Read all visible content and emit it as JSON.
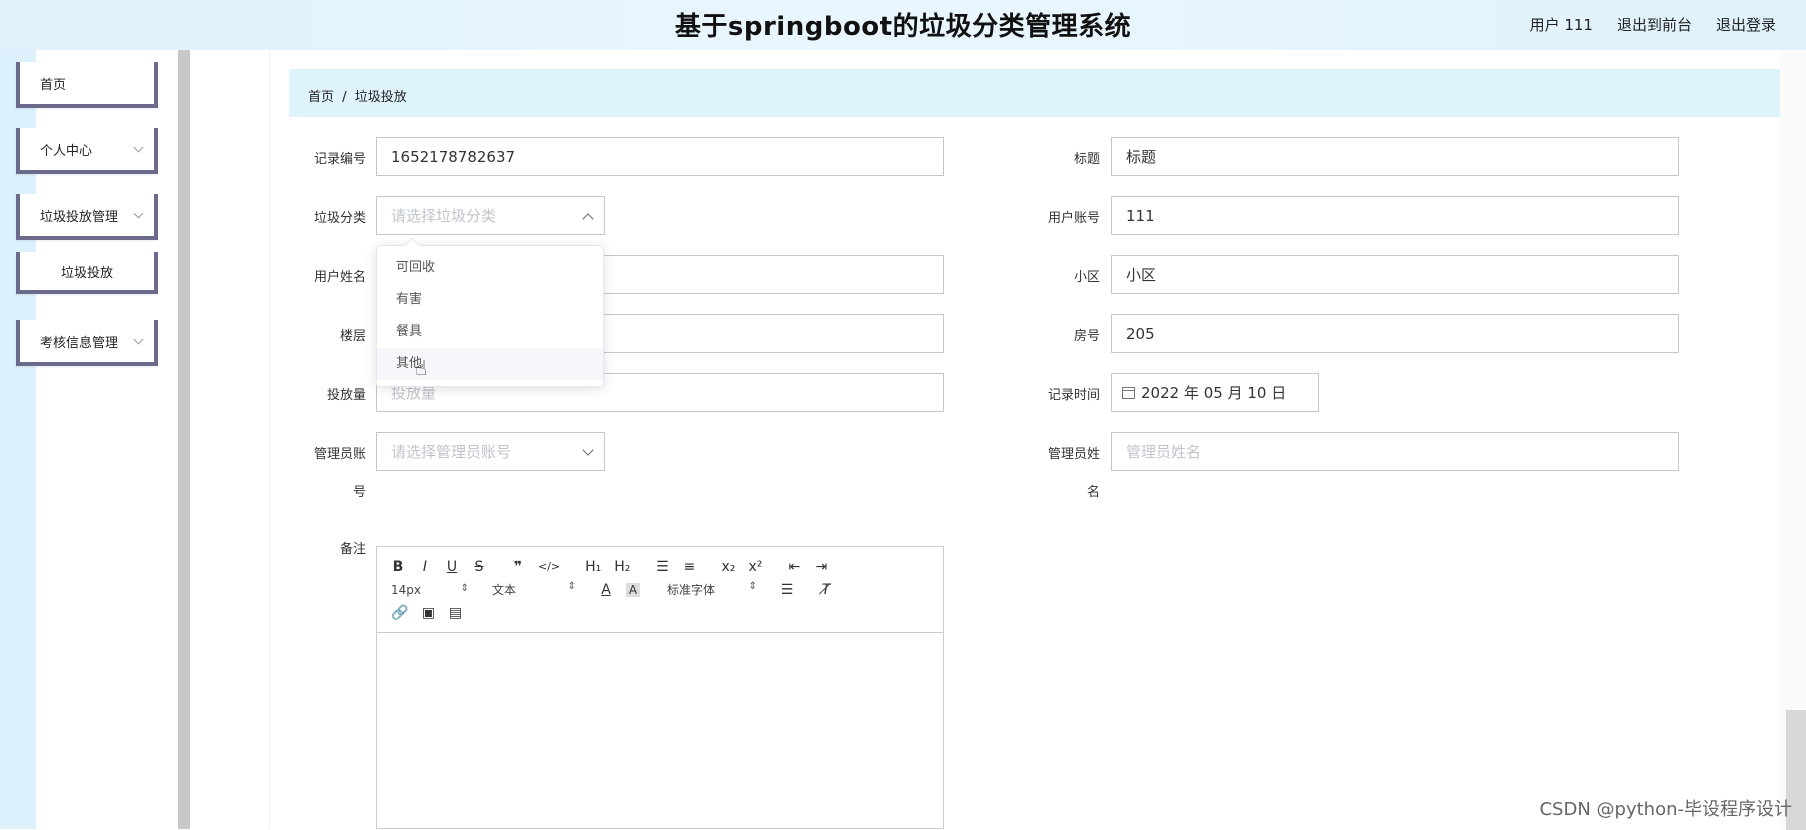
{
  "header": {
    "title": "基于springboot的垃圾分类管理系统",
    "user": "用户 111",
    "front": "退出到前台",
    "logout": "退出登录"
  },
  "sidebar": {
    "items": [
      {
        "label": "首页",
        "has_children": false
      },
      {
        "label": "个人中心",
        "has_children": true
      },
      {
        "label": "垃圾投放管理",
        "has_children": true
      },
      {
        "label": "垃圾投放",
        "has_children": false
      },
      {
        "label": "考核信息管理",
        "has_children": true
      }
    ]
  },
  "breadcrumb": {
    "home": "首页",
    "sep": "/",
    "current": "垃圾投放"
  },
  "form": {
    "record_no": {
      "label": "记录编号",
      "value": "1652178782637"
    },
    "title": {
      "label": "标题",
      "value": "标题"
    },
    "category": {
      "label": "垃圾分类",
      "placeholder": "请选择垃圾分类"
    },
    "account": {
      "label": "用户账号",
      "value": "111"
    },
    "name": {
      "label": "用户姓名",
      "value": ""
    },
    "community": {
      "label": "小区",
      "value": "小区"
    },
    "floor": {
      "label": "楼层",
      "value": ""
    },
    "room": {
      "label": "房号",
      "value": "205"
    },
    "amount": {
      "label": "投放量",
      "placeholder": "投放量"
    },
    "record_time": {
      "label": "记录时间",
      "value": "2022 年 05 月 10 日"
    },
    "admin_account": {
      "label_1": "管理员账",
      "label_2": "号",
      "placeholder": "请选择管理员账号"
    },
    "admin_name": {
      "label_1": "管理员姓",
      "label_2": "名",
      "placeholder": "管理员姓名"
    },
    "notes": {
      "label": "备注"
    }
  },
  "dropdown": {
    "options": [
      "可回收",
      "有害",
      "餐具",
      "其他"
    ],
    "hovered_index": 3
  },
  "editor": {
    "font_size": "14px",
    "block": "文本",
    "font": "标准字体"
  },
  "watermark": "CSDN @python-毕设程序设计"
}
